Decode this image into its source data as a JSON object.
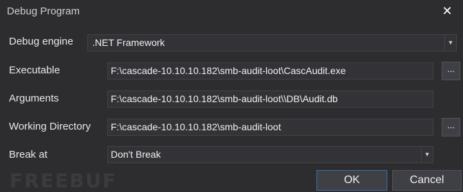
{
  "window": {
    "title": "Debug Program",
    "close_glyph": "✕"
  },
  "form": {
    "engine": {
      "label": "Debug engine",
      "value": ".NET Framework"
    },
    "executable": {
      "label": "Executable",
      "value": "F:\\cascade-10.10.10.182\\smb-audit-loot\\CascAudit.exe",
      "browse_label": "..."
    },
    "arguments": {
      "label": "Arguments",
      "value": "F:\\cascade-10.10.10.182\\smb-audit-loot\\\\DB\\Audit.db"
    },
    "working_directory": {
      "label": "Working Directory",
      "value": "F:\\cascade-10.10.10.182\\smb-audit-loot",
      "browse_label": "..."
    },
    "break_at": {
      "label": "Break at",
      "value": "Don't Break"
    }
  },
  "buttons": {
    "ok": "OK",
    "cancel": "Cancel"
  },
  "watermark": "FREEBUF",
  "icons": {
    "dropdown": "chevron-down-icon",
    "close": "close-icon"
  },
  "colors": {
    "background": "#2d2d30",
    "field": "#333337",
    "border": "#434346",
    "button": "#3f3f46"
  }
}
